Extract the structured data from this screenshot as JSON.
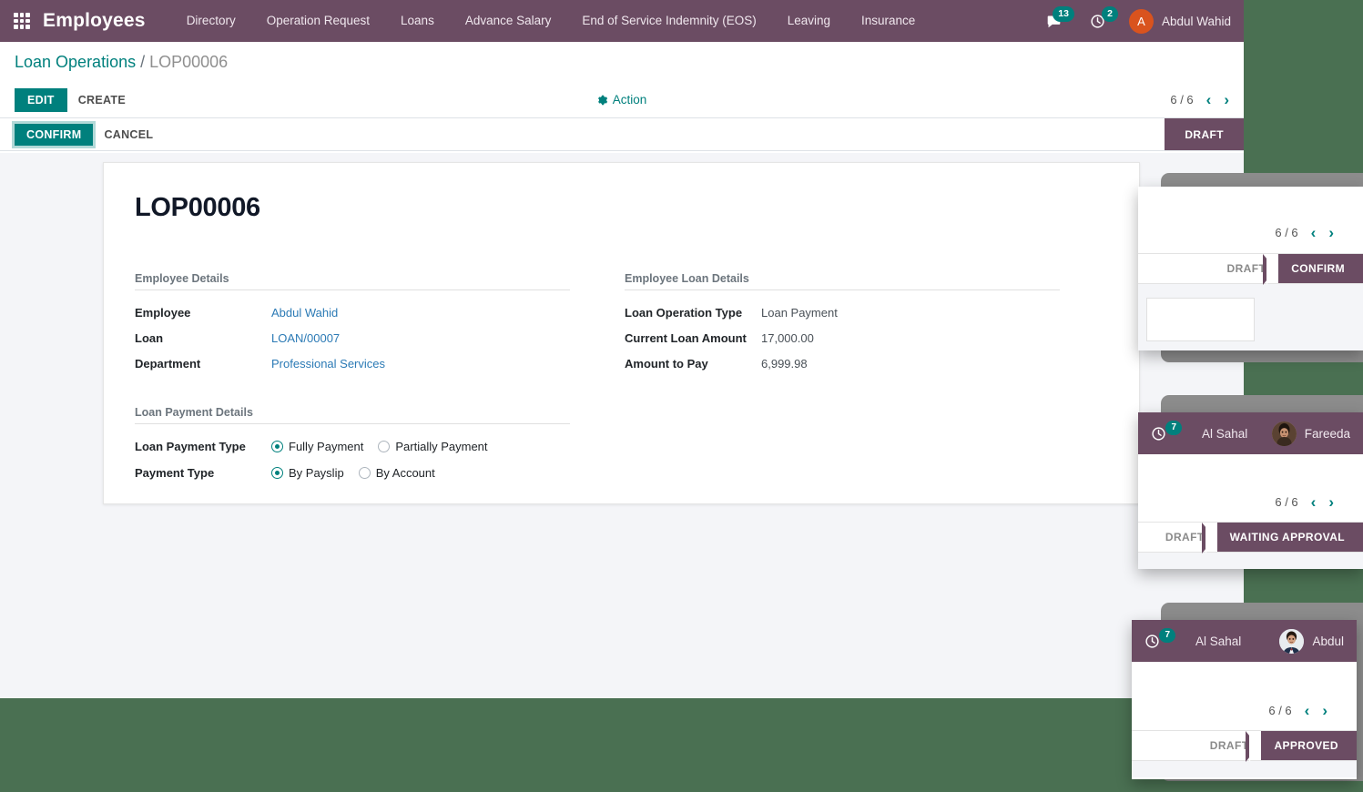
{
  "navbar": {
    "apps_icon": "grid-apps-icon",
    "brand": "Employees",
    "menu_items": [
      {
        "label": "Directory"
      },
      {
        "label": "Operation Request"
      },
      {
        "label": "Loans"
      },
      {
        "label": "Advance Salary"
      },
      {
        "label": "End of Service Indemnity (EOS)"
      },
      {
        "label": "Leaving"
      },
      {
        "label": "Insurance"
      }
    ],
    "messages_count": "13",
    "activities_count": "2",
    "user_initial": "A",
    "user_name": "Abdul Wahid"
  },
  "control_panel": {
    "breadcrumb_root": "Loan Operations",
    "breadcrumb_sep": "/",
    "breadcrumb_current": "LOP00006",
    "edit_label": "EDIT",
    "create_label": "CREATE",
    "action_label": "Action",
    "pager_value": "6 / 6",
    "prev_arrow": "‹",
    "next_arrow": "›"
  },
  "statusbar": {
    "confirm_label": "CONFIRM",
    "cancel_label": "CANCEL",
    "stages": [
      {
        "label": "DRAFT",
        "active": true
      }
    ]
  },
  "form": {
    "record_title": "LOP00006",
    "employee_details": {
      "group_title": "Employee Details",
      "fields": [
        {
          "label": "Employee",
          "value": "Abdul Wahid",
          "type": "link"
        },
        {
          "label": "Loan",
          "value": "LOAN/00007",
          "type": "link"
        },
        {
          "label": "Department",
          "value": "Professional Services",
          "type": "link"
        }
      ]
    },
    "loan_details": {
      "group_title": "Employee Loan Details",
      "fields": [
        {
          "label": "Loan Operation Type",
          "value": "Loan Payment",
          "type": "text"
        },
        {
          "label": "Current Loan Amount",
          "value": "17,000.00",
          "type": "text"
        },
        {
          "label": "Amount to Pay",
          "value": "6,999.98",
          "type": "text"
        }
      ]
    },
    "payment_details": {
      "group_title": "Loan Payment Details",
      "rows": [
        {
          "label": "Loan Payment Type",
          "options": [
            {
              "text": "Fully Payment",
              "selected": true
            },
            {
              "text": "Partially Payment",
              "selected": false
            }
          ]
        },
        {
          "label": "Payment Type",
          "options": [
            {
              "text": "By Payslip",
              "selected": true
            },
            {
              "text": "By Account",
              "selected": false
            }
          ]
        }
      ]
    }
  },
  "preview_cards": [
    {
      "has_navbar": false,
      "pager_value": "6 / 6",
      "prev_arrow": "‹",
      "next_arrow": "›",
      "stage_inactive": "DRAFT",
      "stage_active": "CONFIRM"
    },
    {
      "has_navbar": true,
      "activities_count": "7",
      "company": "Al Sahal",
      "username": "Fareeda",
      "pager_value": "6 / 6",
      "prev_arrow": "‹",
      "next_arrow": "›",
      "stage_inactive": "DRAFT",
      "stage_active": "WAITING APPROVAL"
    },
    {
      "has_navbar": true,
      "activities_count": "7",
      "company": "Al Sahal",
      "username": "Abdul",
      "pager_value": "6 / 6",
      "prev_arrow": "‹",
      "next_arrow": "›",
      "stage_inactive": "DRAFT",
      "stage_active": "APPROVED"
    }
  ],
  "colors": {
    "desktop_background": "#4A7052",
    "navbar_purple": "#6B4C63",
    "accent_teal": "#00807D",
    "avatar_orange": "#D9531E",
    "card_frame_gray": "#8C8C8C",
    "sheet_gray": "#F4F5F8"
  }
}
